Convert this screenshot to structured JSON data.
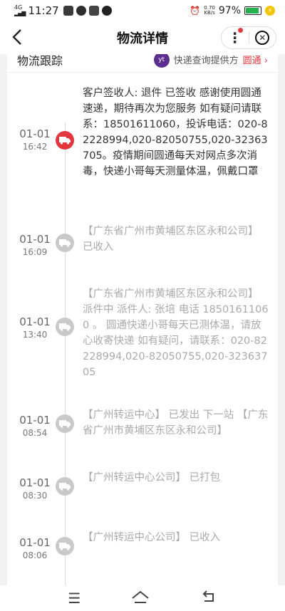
{
  "status_bar": {
    "network": "4G",
    "time": "11:27",
    "speed_value": "0.70",
    "speed_unit": "KB/s",
    "battery": "97%"
  },
  "header": {
    "title": "物流详情"
  },
  "tracking": {
    "section_title": "物流跟踪",
    "provider_label": "快递查询提供方",
    "provider_link": "圆通",
    "provider_logo": "yt"
  },
  "events": [
    {
      "date": "01-01",
      "time": "16:42",
      "text": "客户签收人: 退件 已签收 感谢使用圆通速递，期待再次为您服务 如有疑问请联系：18501611060，投诉电话：020-82228994,020-82050755,020-32363705。疫情期间圆通每天对网点多次消毒，快递小哥每天测量体温，佩戴口罩",
      "active": true
    },
    {
      "date": "01-01",
      "time": "16:09",
      "text": "【广东省广州市黄埔区东区永和公司】 已收入",
      "active": false
    },
    {
      "date": "01-01",
      "time": "13:40",
      "text": "【广东省广州市黄埔区东区永和公司】 派件中 派件人: 张培 电话 18501611060 。 圆通快递小哥每天已测体温，请放心收寄快递 如有疑问，请联系：020-82228994,020-82050755,020-32363705",
      "active": false
    },
    {
      "date": "01-01",
      "time": "08:54",
      "text": "【广州转运中心】 已发出 下一站 【广东省广州市黄埔区东区永和公司】",
      "active": false
    },
    {
      "date": "01-01",
      "time": "08:30",
      "text": "【广州转运中心公司】 已打包",
      "active": false
    },
    {
      "date": "01-01",
      "time": "08:06",
      "text": "【广州转运中心公司】 已收入",
      "active": false
    }
  ],
  "nav": {
    "menu": "menu-icon",
    "home": "home-icon",
    "back": "back-icon"
  }
}
